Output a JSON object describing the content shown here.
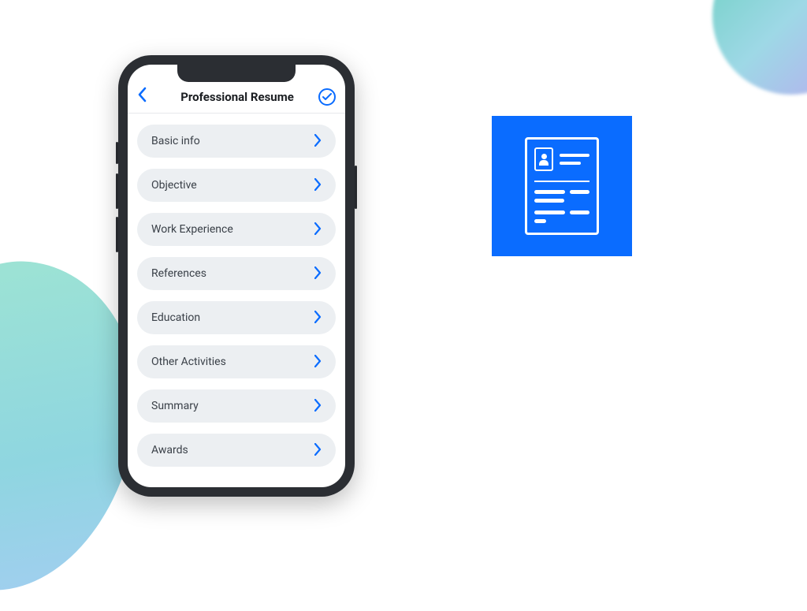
{
  "colors": {
    "accent": "#0a6cff",
    "rowBg": "#eceff2",
    "text": "#3a4048"
  },
  "header": {
    "title": "Professional Resume"
  },
  "menu": {
    "items": [
      {
        "label": "Basic info"
      },
      {
        "label": "Objective"
      },
      {
        "label": "Work Experience"
      },
      {
        "label": "References"
      },
      {
        "label": "Education"
      },
      {
        "label": "Other Activities"
      },
      {
        "label": "Summary"
      },
      {
        "label": "Awards"
      }
    ]
  },
  "appIcon": {
    "name": "resume-document-icon"
  }
}
